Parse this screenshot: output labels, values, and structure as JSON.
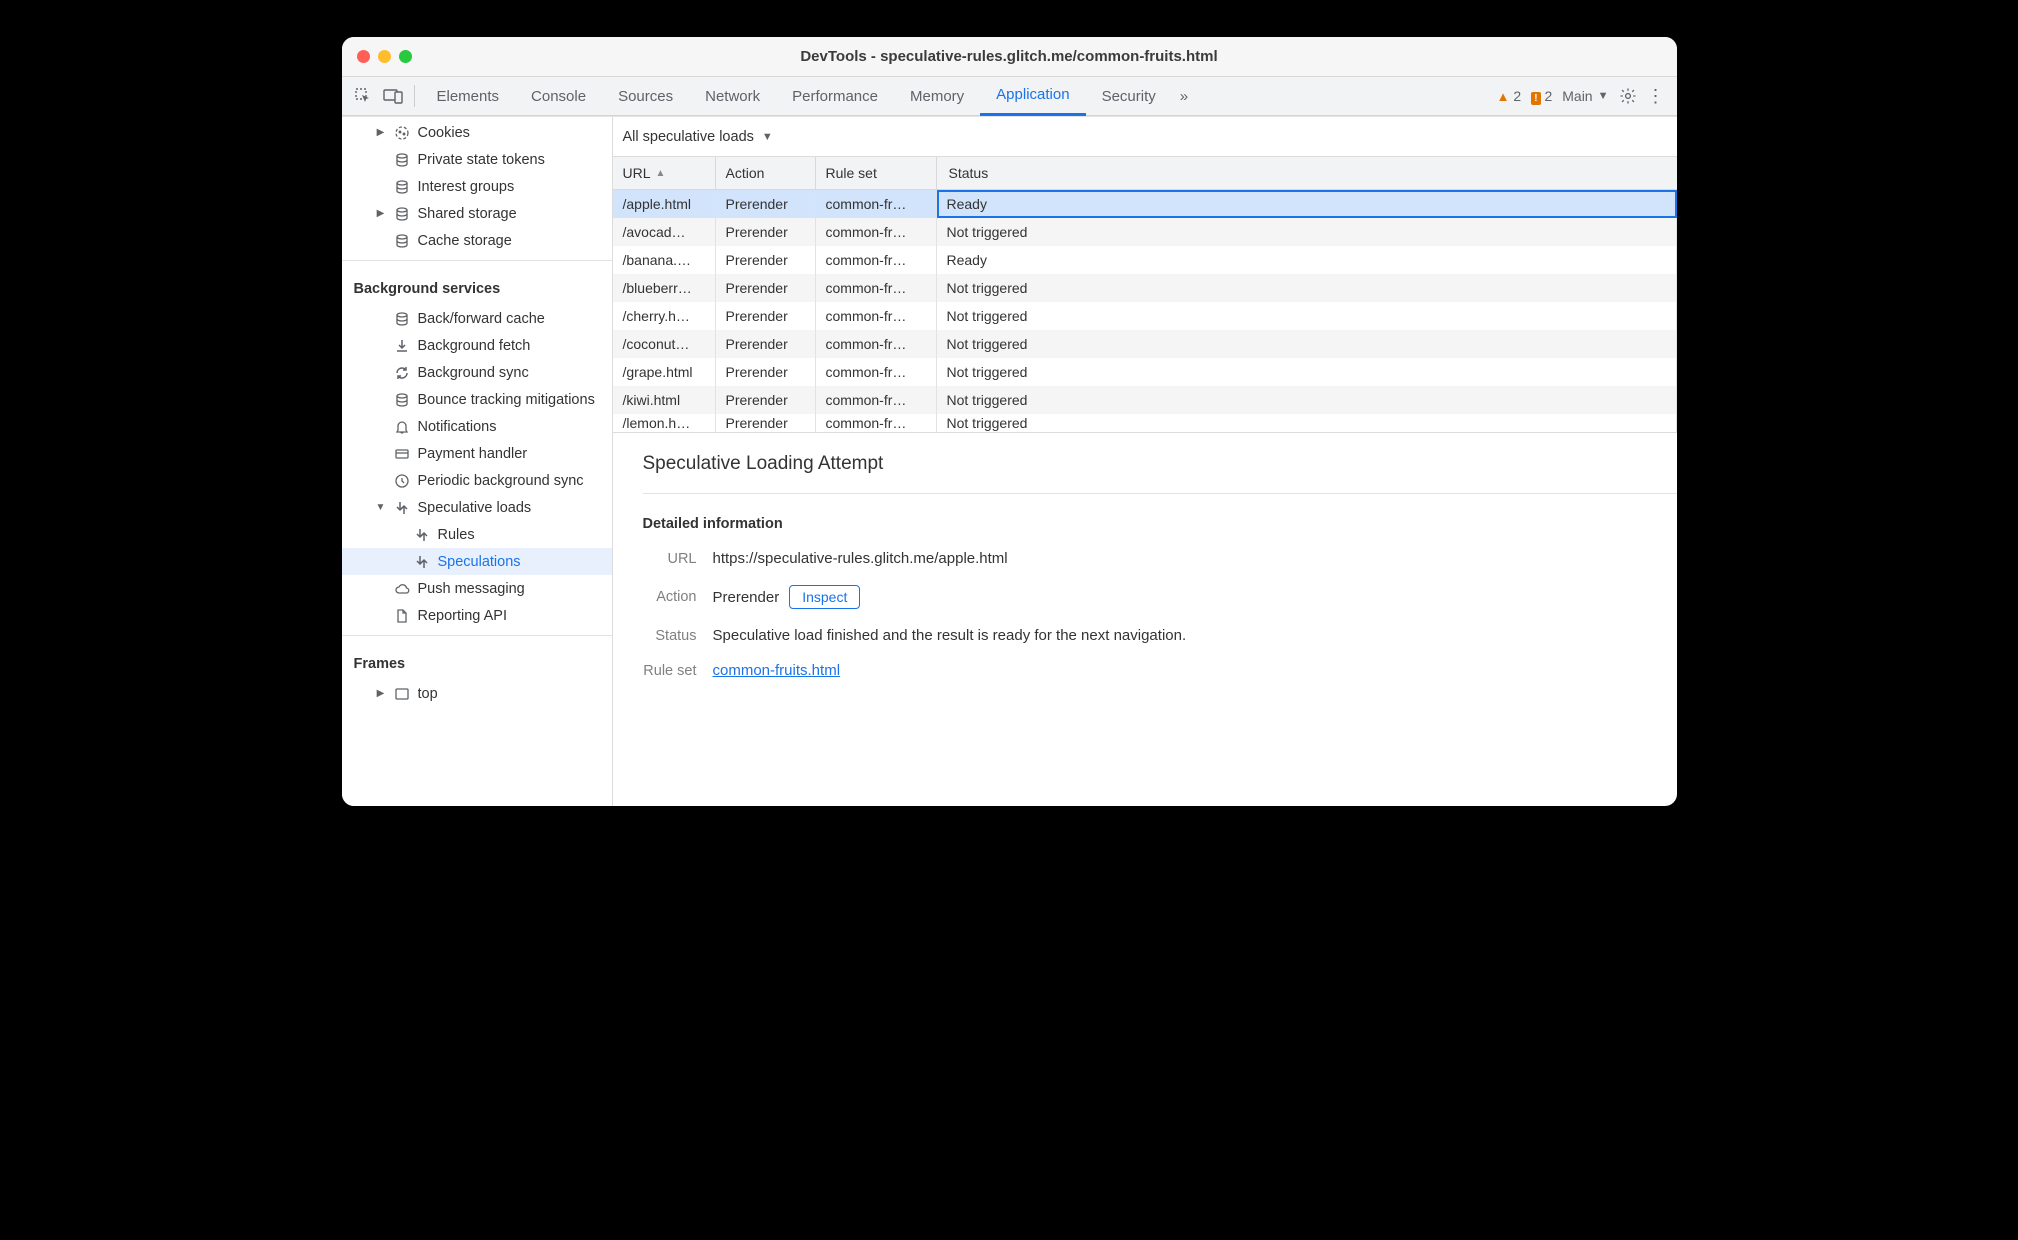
{
  "window_title": "DevTools - speculative-rules.glitch.me/common-fruits.html",
  "tabs": [
    "Elements",
    "Console",
    "Sources",
    "Network",
    "Performance",
    "Memory",
    "Application",
    "Security"
  ],
  "active_tab": "Application",
  "overflow_glyph": "»",
  "warnings_count": "2",
  "issues_count": "2",
  "main_label": "Main",
  "sidebar": {
    "storage_items": [
      {
        "label": "Cookies",
        "icon": "cookie",
        "expandable": true
      },
      {
        "label": "Private state tokens",
        "icon": "db"
      },
      {
        "label": "Interest groups",
        "icon": "db"
      },
      {
        "label": "Shared storage",
        "icon": "db",
        "expandable": true
      },
      {
        "label": "Cache storage",
        "icon": "db"
      }
    ],
    "bg_section": "Background services",
    "bg_items": [
      {
        "label": "Back/forward cache",
        "icon": "db"
      },
      {
        "label": "Background fetch",
        "icon": "fetch"
      },
      {
        "label": "Background sync",
        "icon": "sync"
      },
      {
        "label": "Bounce tracking mitigations",
        "icon": "db"
      },
      {
        "label": "Notifications",
        "icon": "bell"
      },
      {
        "label": "Payment handler",
        "icon": "card"
      },
      {
        "label": "Periodic background sync",
        "icon": "clock"
      },
      {
        "label": "Speculative loads",
        "icon": "spec",
        "expandable": true,
        "expanded": true
      },
      {
        "label": "Rules",
        "icon": "spec",
        "indent": 2
      },
      {
        "label": "Speculations",
        "icon": "spec",
        "indent": 2,
        "selected": true
      },
      {
        "label": "Push messaging",
        "icon": "cloud"
      },
      {
        "label": "Reporting API",
        "icon": "doc"
      }
    ],
    "frames_section": "Frames",
    "frames": [
      {
        "label": "top",
        "icon": "frame",
        "expandable": true
      }
    ]
  },
  "filter_label": "All speculative loads",
  "columns": [
    "URL",
    "Action",
    "Rule set",
    "Status"
  ],
  "rows": [
    {
      "url": "/apple.html",
      "action": "Prerender",
      "ruleset": "common-fr…",
      "status": "Ready",
      "selected": true
    },
    {
      "url": "/avocad…",
      "action": "Prerender",
      "ruleset": "common-fr…",
      "status": "Not triggered"
    },
    {
      "url": "/banana.…",
      "action": "Prerender",
      "ruleset": "common-fr…",
      "status": "Ready"
    },
    {
      "url": "/blueberr…",
      "action": "Prerender",
      "ruleset": "common-fr…",
      "status": "Not triggered"
    },
    {
      "url": "/cherry.h…",
      "action": "Prerender",
      "ruleset": "common-fr…",
      "status": "Not triggered"
    },
    {
      "url": "/coconut…",
      "action": "Prerender",
      "ruleset": "common-fr…",
      "status": "Not triggered"
    },
    {
      "url": "/grape.html",
      "action": "Prerender",
      "ruleset": "common-fr…",
      "status": "Not triggered"
    },
    {
      "url": "/kiwi.html",
      "action": "Prerender",
      "ruleset": "common-fr…",
      "status": "Not triggered"
    },
    {
      "url": "/lemon.h…",
      "action": "Prerender",
      "ruleset": "common-fr…",
      "status": "Not triggered",
      "clipped": true
    }
  ],
  "detail": {
    "title": "Speculative Loading Attempt",
    "section": "Detailed information",
    "url_k": "URL",
    "url_v": "https://speculative-rules.glitch.me/apple.html",
    "action_k": "Action",
    "action_v": "Prerender",
    "inspect": "Inspect",
    "status_k": "Status",
    "status_v": "Speculative load finished and the result is ready for the next navigation.",
    "ruleset_k": "Rule set",
    "ruleset_v": "common-fruits.html"
  }
}
